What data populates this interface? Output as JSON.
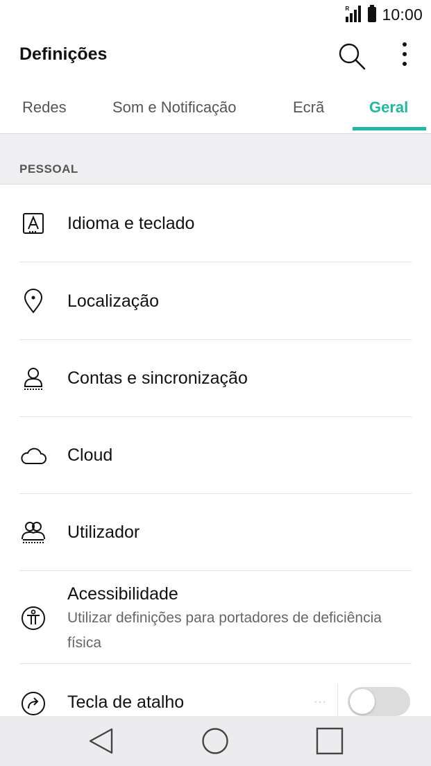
{
  "status_bar": {
    "time": "10:00",
    "roaming": "R"
  },
  "app_bar": {
    "title": "Definições"
  },
  "tabs": [
    {
      "label": "Redes"
    },
    {
      "label": "Som e Notificação"
    },
    {
      "label": "Ecrã"
    },
    {
      "label": "Geral",
      "active": true
    }
  ],
  "section": {
    "label": "PESSOAL"
  },
  "items": [
    {
      "label": "Idioma e teclado",
      "icon": "language-icon"
    },
    {
      "label": "Localização",
      "icon": "location-pin-icon"
    },
    {
      "label": "Contas e sincronização",
      "icon": "account-icon"
    },
    {
      "label": "Cloud",
      "icon": "cloud-icon"
    },
    {
      "label": "Utilizador",
      "icon": "users-icon"
    },
    {
      "label": "Acessibilidade",
      "subtitle": "Utilizar definições para portadores de deficiência física",
      "icon": "accessibility-icon"
    },
    {
      "label": "Tecla de atalho",
      "icon": "shortcut-icon",
      "toggle_on": false
    }
  ],
  "more_dots": "···",
  "colors": {
    "accent": "#1fb8a0",
    "section_bg": "#efeff1",
    "navbar_bg": "#ececee"
  }
}
